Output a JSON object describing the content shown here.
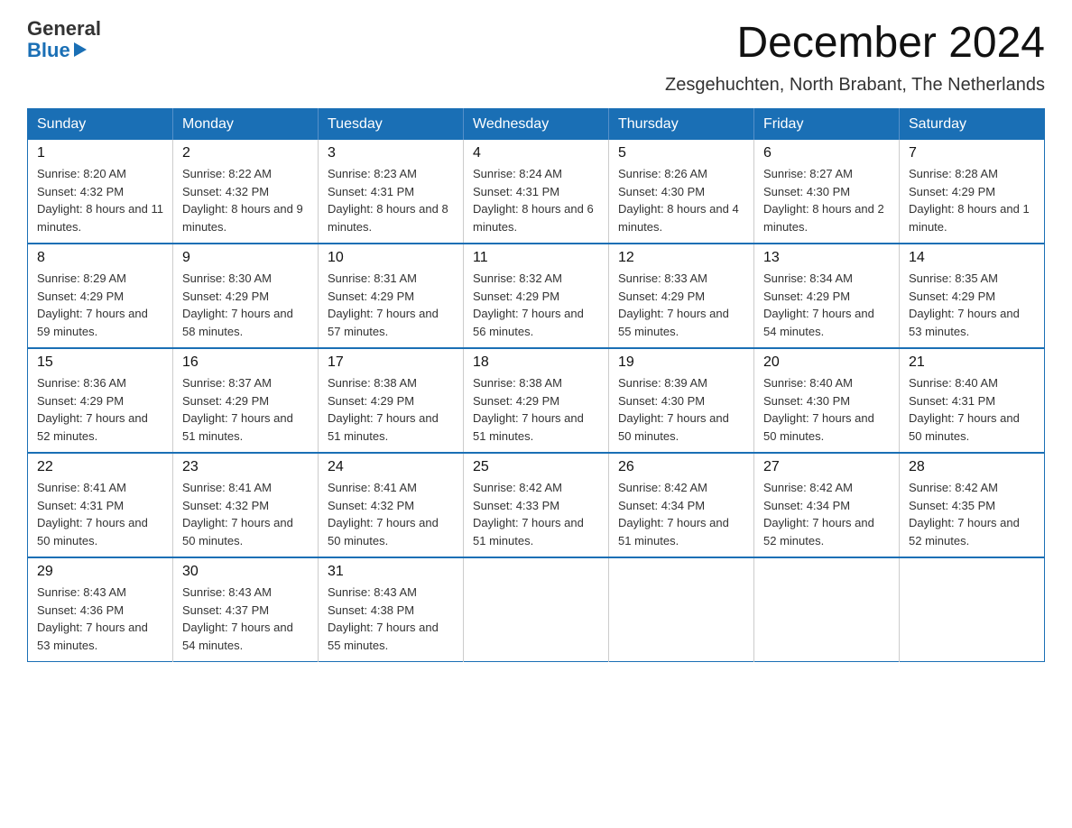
{
  "header": {
    "logo_general": "General",
    "logo_blue": "Blue",
    "title": "December 2024",
    "subtitle": "Zesgehuchten, North Brabant, The Netherlands"
  },
  "days_of_week": [
    "Sunday",
    "Monday",
    "Tuesday",
    "Wednesday",
    "Thursday",
    "Friday",
    "Saturday"
  ],
  "weeks": [
    [
      {
        "day": "1",
        "sunrise": "8:20 AM",
        "sunset": "4:32 PM",
        "daylight": "8 hours and 11 minutes."
      },
      {
        "day": "2",
        "sunrise": "8:22 AM",
        "sunset": "4:32 PM",
        "daylight": "8 hours and 9 minutes."
      },
      {
        "day": "3",
        "sunrise": "8:23 AM",
        "sunset": "4:31 PM",
        "daylight": "8 hours and 8 minutes."
      },
      {
        "day": "4",
        "sunrise": "8:24 AM",
        "sunset": "4:31 PM",
        "daylight": "8 hours and 6 minutes."
      },
      {
        "day": "5",
        "sunrise": "8:26 AM",
        "sunset": "4:30 PM",
        "daylight": "8 hours and 4 minutes."
      },
      {
        "day": "6",
        "sunrise": "8:27 AM",
        "sunset": "4:30 PM",
        "daylight": "8 hours and 2 minutes."
      },
      {
        "day": "7",
        "sunrise": "8:28 AM",
        "sunset": "4:29 PM",
        "daylight": "8 hours and 1 minute."
      }
    ],
    [
      {
        "day": "8",
        "sunrise": "8:29 AM",
        "sunset": "4:29 PM",
        "daylight": "7 hours and 59 minutes."
      },
      {
        "day": "9",
        "sunrise": "8:30 AM",
        "sunset": "4:29 PM",
        "daylight": "7 hours and 58 minutes."
      },
      {
        "day": "10",
        "sunrise": "8:31 AM",
        "sunset": "4:29 PM",
        "daylight": "7 hours and 57 minutes."
      },
      {
        "day": "11",
        "sunrise": "8:32 AM",
        "sunset": "4:29 PM",
        "daylight": "7 hours and 56 minutes."
      },
      {
        "day": "12",
        "sunrise": "8:33 AM",
        "sunset": "4:29 PM",
        "daylight": "7 hours and 55 minutes."
      },
      {
        "day": "13",
        "sunrise": "8:34 AM",
        "sunset": "4:29 PM",
        "daylight": "7 hours and 54 minutes."
      },
      {
        "day": "14",
        "sunrise": "8:35 AM",
        "sunset": "4:29 PM",
        "daylight": "7 hours and 53 minutes."
      }
    ],
    [
      {
        "day": "15",
        "sunrise": "8:36 AM",
        "sunset": "4:29 PM",
        "daylight": "7 hours and 52 minutes."
      },
      {
        "day": "16",
        "sunrise": "8:37 AM",
        "sunset": "4:29 PM",
        "daylight": "7 hours and 51 minutes."
      },
      {
        "day": "17",
        "sunrise": "8:38 AM",
        "sunset": "4:29 PM",
        "daylight": "7 hours and 51 minutes."
      },
      {
        "day": "18",
        "sunrise": "8:38 AM",
        "sunset": "4:29 PM",
        "daylight": "7 hours and 51 minutes."
      },
      {
        "day": "19",
        "sunrise": "8:39 AM",
        "sunset": "4:30 PM",
        "daylight": "7 hours and 50 minutes."
      },
      {
        "day": "20",
        "sunrise": "8:40 AM",
        "sunset": "4:30 PM",
        "daylight": "7 hours and 50 minutes."
      },
      {
        "day": "21",
        "sunrise": "8:40 AM",
        "sunset": "4:31 PM",
        "daylight": "7 hours and 50 minutes."
      }
    ],
    [
      {
        "day": "22",
        "sunrise": "8:41 AM",
        "sunset": "4:31 PM",
        "daylight": "7 hours and 50 minutes."
      },
      {
        "day": "23",
        "sunrise": "8:41 AM",
        "sunset": "4:32 PM",
        "daylight": "7 hours and 50 minutes."
      },
      {
        "day": "24",
        "sunrise": "8:41 AM",
        "sunset": "4:32 PM",
        "daylight": "7 hours and 50 minutes."
      },
      {
        "day": "25",
        "sunrise": "8:42 AM",
        "sunset": "4:33 PM",
        "daylight": "7 hours and 51 minutes."
      },
      {
        "day": "26",
        "sunrise": "8:42 AM",
        "sunset": "4:34 PM",
        "daylight": "7 hours and 51 minutes."
      },
      {
        "day": "27",
        "sunrise": "8:42 AM",
        "sunset": "4:34 PM",
        "daylight": "7 hours and 52 minutes."
      },
      {
        "day": "28",
        "sunrise": "8:42 AM",
        "sunset": "4:35 PM",
        "daylight": "7 hours and 52 minutes."
      }
    ],
    [
      {
        "day": "29",
        "sunrise": "8:43 AM",
        "sunset": "4:36 PM",
        "daylight": "7 hours and 53 minutes."
      },
      {
        "day": "30",
        "sunrise": "8:43 AM",
        "sunset": "4:37 PM",
        "daylight": "7 hours and 54 minutes."
      },
      {
        "day": "31",
        "sunrise": "8:43 AM",
        "sunset": "4:38 PM",
        "daylight": "7 hours and 55 minutes."
      },
      null,
      null,
      null,
      null
    ]
  ]
}
